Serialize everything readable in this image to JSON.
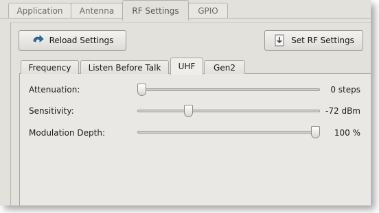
{
  "outer_tabs": [
    "Application",
    "Antenna",
    "RF Settings",
    "GPIO"
  ],
  "outer_active": "RF Settings",
  "buttons": {
    "reload": "Reload Settings",
    "set_rf": "Set RF Settings"
  },
  "inner_tabs": [
    "Frequency",
    "Listen Before Talk",
    "UHF",
    "Gen2"
  ],
  "inner_active": "UHF",
  "sliders": [
    {
      "label": "Attenuation:",
      "value_text": "0 steps",
      "level": 0.0
    },
    {
      "label": "Sensitivity:",
      "value_text": "-72 dBm",
      "level": 0.27
    },
    {
      "label": "Modulation Depth:",
      "value_text": "100 %",
      "level": 1.0
    }
  ],
  "colors": {
    "window_bg": "#e3e1dc",
    "accent_arrow": "#2a6fb0"
  },
  "icons": {
    "reload": "reload-arrow-icon",
    "set_rf": "upload-document-icon"
  }
}
